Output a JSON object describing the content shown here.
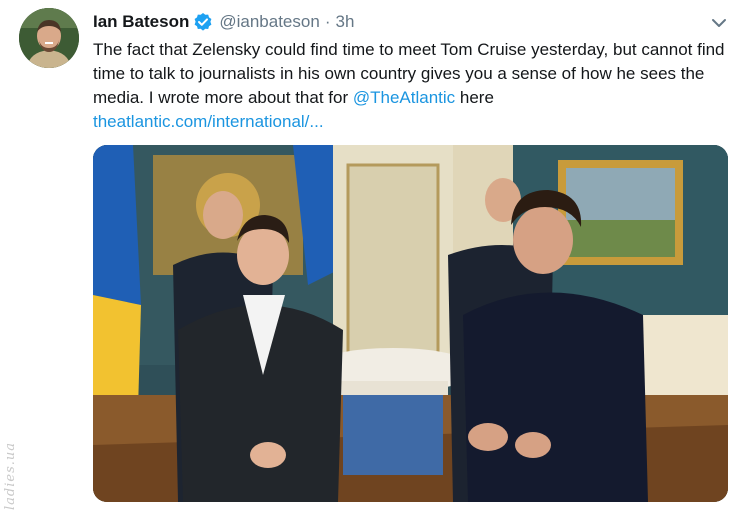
{
  "tweet": {
    "author_name": "Ian Bateson",
    "handle": "@ianbateson",
    "separator": "·",
    "time": "3h",
    "text_before_mention": "The fact that Zelensky could find time to meet Tom Cruise yesterday, but cannot find time to talk to journalists in his own country gives you a sense of how he sees the media. I wrote more about that for ",
    "mention": "@TheAtlantic",
    "text_after_mention": " here",
    "link": "theatlantic.com/international/...",
    "photo_description": "Zelensky and Tom Cruise meeting in an ornate room",
    "icons": {
      "avatar": "avatar",
      "verified": "verified-badge-icon",
      "more": "chevron-down-icon"
    },
    "colors": {
      "link": "#1b95e0",
      "muted": "#657786",
      "verified": "#1da1f2"
    }
  },
  "watermark": "ladies.ua"
}
